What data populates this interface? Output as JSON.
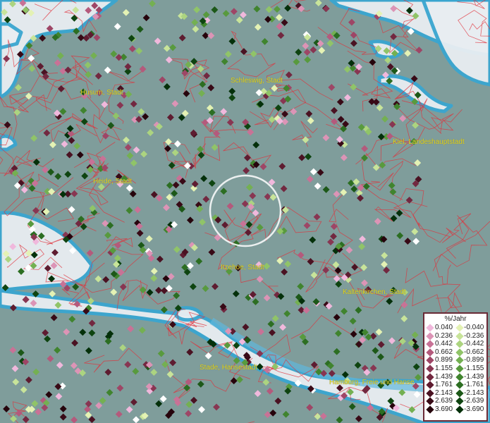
{
  "map": {
    "colors": {
      "land": "#7f9d9b",
      "water": "#e9eef2",
      "coast": "#3aa6d0",
      "borders": "#e0303a",
      "marker_white": "#ffffff",
      "highlight_ring": "#ffffff"
    },
    "cities": [
      {
        "name": "Husum, Stadt",
        "id": "husum"
      },
      {
        "name": "Schleswig, Stadt",
        "id": "schleswig"
      },
      {
        "name": "Kiel, Landeshauptstadt",
        "id": "kiel"
      },
      {
        "name": "Heide, Stadt",
        "id": "heide"
      },
      {
        "name": "Itzehoe, Stadt",
        "id": "itzehoe"
      },
      {
        "name": "Kaltenkirchen, Stadt",
        "id": "kaltenkirchen"
      },
      {
        "name": "Stade, Hansestadt",
        "id": "stade"
      },
      {
        "name": "Hamburg, Freie und Hanse",
        "id": "hamburg"
      }
    ]
  },
  "legend": {
    "title": "%/Jahr",
    "positive": [
      {
        "label": "0.040",
        "color": "#f0b8dc"
      },
      {
        "label": "0.236",
        "color": "#dc94b6"
      },
      {
        "label": "0.442",
        "color": "#c87296"
      },
      {
        "label": "0.662",
        "color": "#b45a7c"
      },
      {
        "label": "0.899",
        "color": "#9e4666"
      },
      {
        "label": "1.155",
        "color": "#883652"
      },
      {
        "label": "1.439",
        "color": "#722840"
      },
      {
        "label": "1.761",
        "color": "#5e1c30"
      },
      {
        "label": "2.143",
        "color": "#4a1222"
      },
      {
        "label": "2.639",
        "color": "#380a16"
      },
      {
        "label": "3.690",
        "color": "#26040c"
      }
    ],
    "negative": [
      {
        "label": "-0.040",
        "color": "#e4f2b4"
      },
      {
        "label": "-0.236",
        "color": "#c8e49a"
      },
      {
        "label": "-0.442",
        "color": "#acd480"
      },
      {
        "label": "-0.662",
        "color": "#90c468"
      },
      {
        "label": "-0.899",
        "color": "#74b052"
      },
      {
        "label": "-1.155",
        "color": "#589a3e"
      },
      {
        "label": "-1.439",
        "color": "#40842e"
      },
      {
        "label": "-1.761",
        "color": "#2c6e22"
      },
      {
        "label": "-2.143",
        "color": "#1c5818"
      },
      {
        "label": "-2.639",
        "color": "#0e4410"
      },
      {
        "label": "-3.690",
        "color": "#04300a"
      }
    ]
  }
}
